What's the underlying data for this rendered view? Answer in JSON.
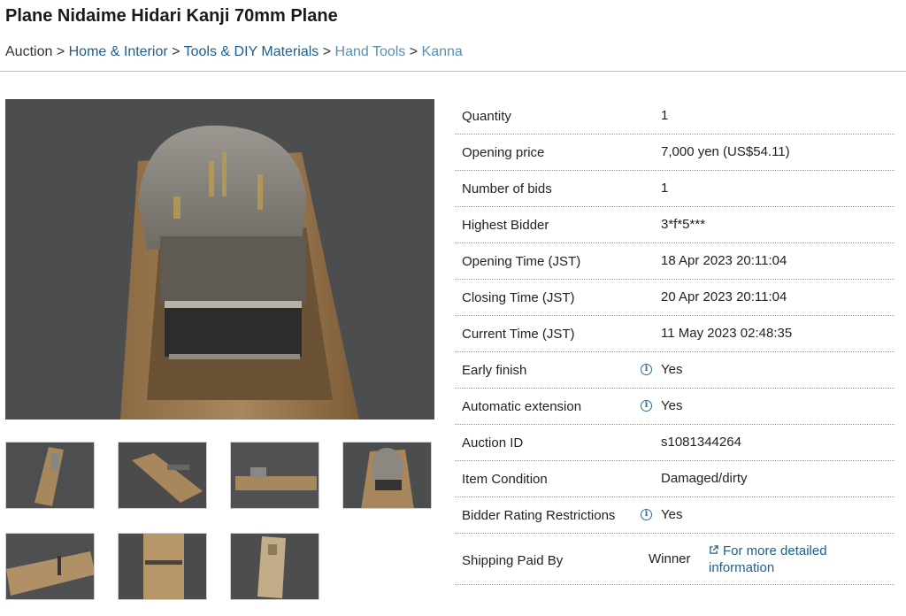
{
  "page": {
    "title": "Plane Nidaime Hidari Kanji 70mm Plane"
  },
  "breadcrumb": {
    "root": "Auction",
    "separator": ">",
    "items": [
      "Home & Interior",
      "Tools & DIY Materials",
      "Hand Tools",
      "Kanna"
    ]
  },
  "gallery": {
    "thumbnail_count": 7
  },
  "details": {
    "quantity": {
      "label": "Quantity",
      "value": "1"
    },
    "opening_price": {
      "label": "Opening price",
      "value": "7,000 yen (US$54.11)"
    },
    "number_of_bids": {
      "label": "Number of bids",
      "value": "1"
    },
    "highest_bidder": {
      "label": "Highest Bidder",
      "value": "3*f*5***"
    },
    "opening_time": {
      "label": "Opening Time (JST)",
      "value": "18 Apr 2023 20:11:04"
    },
    "closing_time": {
      "label": "Closing Time (JST)",
      "value": "20 Apr 2023 20:11:04"
    },
    "current_time": {
      "label": "Current Time (JST)",
      "value": "11 May 2023 02:48:35"
    },
    "early_finish": {
      "label": "Early finish",
      "value": "Yes"
    },
    "automatic_extension": {
      "label": "Automatic extension",
      "value": "Yes"
    },
    "auction_id": {
      "label": "Auction ID",
      "value": "s1081344264"
    },
    "item_condition": {
      "label": "Item Condition",
      "value": "Damaged/dirty"
    },
    "bidder_rating_restrictions": {
      "label": "Bidder Rating Restrictions",
      "value": "Yes"
    },
    "shipping_paid_by": {
      "label": "Shipping Paid By",
      "value": "Winner",
      "link_text": "For more detailed information"
    }
  },
  "icons": {
    "info": "info-circle-icon",
    "external_link": "external-link-icon"
  },
  "colors": {
    "link": "#1f5e8c",
    "link_muted": "#5a8fb0",
    "info_icon": "#2f6d93"
  }
}
